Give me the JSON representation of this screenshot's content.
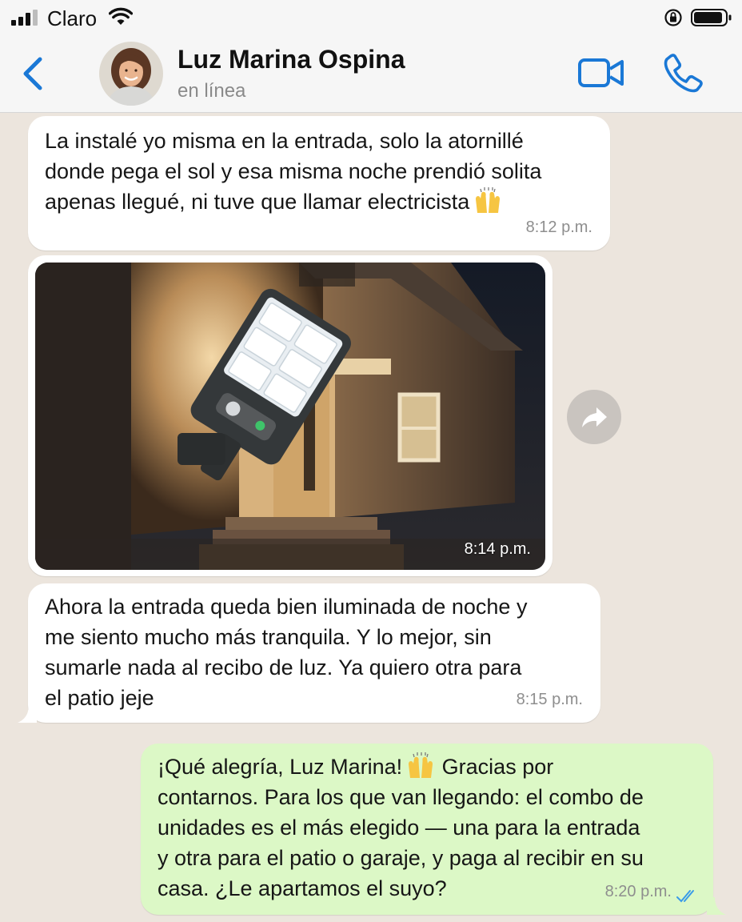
{
  "status_bar": {
    "carrier": "Claro",
    "signal_icon": "signal-bars-icon",
    "wifi_icon": "wifi-icon",
    "rotation_lock_icon": "rotation-lock-icon",
    "battery_icon": "battery-icon"
  },
  "header": {
    "back_icon": "chevron-left-icon",
    "contact_name": "Luz Marina Ospina",
    "contact_status": "en línea",
    "video_icon": "video-camera-icon",
    "phone_icon": "phone-icon",
    "accent_color": "#1a78d6"
  },
  "messages": [
    {
      "direction": "incoming",
      "text": "La instalé yo misma en la entrada, solo la atornillé\ndonde pega el sol y esa misma noche prendió solita\napenas llegué, ni tuve que llamar electricista",
      "emoji": "raising-hands-emoji",
      "time": "8:12 p.m."
    },
    {
      "direction": "incoming",
      "type": "image",
      "image_description_icon": "solar-wall-lamp-photo",
      "time": "8:14 p.m.",
      "forward_icon": "forward-arrow-icon"
    },
    {
      "direction": "incoming",
      "text": "Ahora la entrada queda bien iluminada de noche y\nme siento mucho más tranquila. Y lo mejor, sin\nsumarle nada al recibo de luz. Ya quiero otra para\nel patio jeje",
      "time": "8:15 p.m."
    },
    {
      "direction": "outgoing",
      "text_part1": "¡Qué alegría, Luz Marina!",
      "emoji": "raising-hands-emoji",
      "text_part2": "Gracias por\ncontarnos. Para los que van llegando: el combo de\nunidades es el más elegido — una para la entrada\ny otra para el patio o garaje, y paga al recibir en su\ncasa. ¿Le apartamos el suyo?",
      "time": "8:20 p.m.",
      "read_icon": "double-check-read-icon",
      "bubble_color": "#dcf8c6"
    }
  ]
}
